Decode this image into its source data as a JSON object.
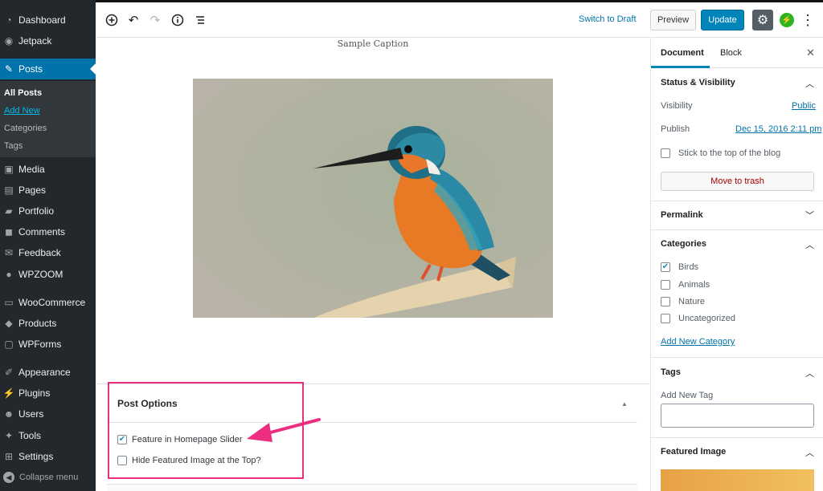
{
  "admin_menu": {
    "items": [
      {
        "label": "Dashboard",
        "icon": "dashboard-icon"
      },
      {
        "label": "Jetpack",
        "icon": "jetpack-icon"
      },
      {
        "label": "Posts",
        "icon": "pin-icon"
      },
      {
        "label": "Media",
        "icon": "media-icon"
      },
      {
        "label": "Pages",
        "icon": "pages-icon"
      },
      {
        "label": "Portfolio",
        "icon": "portfolio-icon"
      },
      {
        "label": "Comments",
        "icon": "comments-icon"
      },
      {
        "label": "Feedback",
        "icon": "feedback-icon"
      },
      {
        "label": "WPZOOM",
        "icon": "wpzoom-icon"
      },
      {
        "label": "WooCommerce",
        "icon": "woocommerce-icon"
      },
      {
        "label": "Products",
        "icon": "products-icon"
      },
      {
        "label": "WPForms",
        "icon": "wpforms-icon"
      },
      {
        "label": "Appearance",
        "icon": "appearance-icon"
      },
      {
        "label": "Plugins",
        "icon": "plugins-icon"
      },
      {
        "label": "Users",
        "icon": "users-icon"
      },
      {
        "label": "Tools",
        "icon": "tools-icon"
      },
      {
        "label": "Settings",
        "icon": "settings-icon"
      }
    ],
    "submenu": [
      "All Posts",
      "Add New",
      "Categories",
      "Tags"
    ],
    "collapse_label": "Collapse menu"
  },
  "toolbar": {
    "switch_to_draft": "Switch to Draft",
    "preview": "Preview",
    "update": "Update"
  },
  "editor": {
    "caption": "Sample Caption"
  },
  "post_options": {
    "title": "Post Options",
    "options": [
      {
        "label": "Feature in Homepage Slider",
        "checked": true
      },
      {
        "label": "Hide Featured Image at the Top?",
        "checked": false
      }
    ]
  },
  "sidebar": {
    "tabs": [
      "Document",
      "Block"
    ],
    "status_visibility": {
      "title": "Status & Visibility",
      "visibility_label": "Visibility",
      "visibility_value": "Public",
      "publish_label": "Publish",
      "publish_value": "Dec 15, 2016 2:11 pm",
      "sticky_label": "Stick to the top of the blog",
      "trash_label": "Move to trash"
    },
    "permalink_title": "Permalink",
    "categories": {
      "title": "Categories",
      "items": [
        {
          "label": "Birds",
          "checked": true
        },
        {
          "label": "Animals",
          "checked": false
        },
        {
          "label": "Nature",
          "checked": false
        },
        {
          "label": "Uncategorized",
          "checked": false
        }
      ],
      "add_new": "Add New Category"
    },
    "tags": {
      "title": "Tags",
      "add_label": "Add New Tag"
    },
    "featured_image_title": "Featured Image"
  },
  "colors": {
    "admin_bg": "#23282d",
    "accent": "#0073aa",
    "highlight": "#ed2e7e",
    "update_btn": "#0085ba"
  }
}
